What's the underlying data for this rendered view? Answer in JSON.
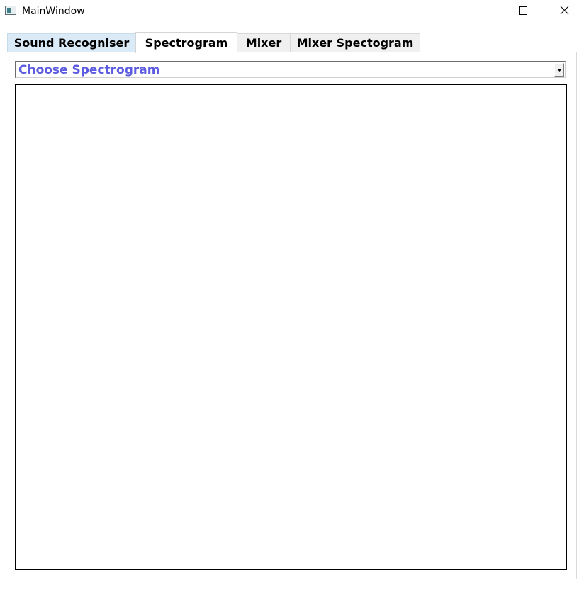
{
  "window": {
    "title": "MainWindow",
    "icon": "app-window-icon",
    "controls": [
      "minimize-icon",
      "maximize-icon",
      "close-icon"
    ]
  },
  "tabs": [
    {
      "label": "Sound Recogniser",
      "selected": false,
      "hovered": true
    },
    {
      "label": "Spectrogram",
      "selected": true
    },
    {
      "label": "Mixer",
      "selected": false
    },
    {
      "label": "Mixer Spectogram",
      "selected": false
    }
  ],
  "spectrogram_tab": {
    "combo": {
      "placeholder": "Choose Spectrogram",
      "text_color": "#5c5ce0",
      "arrow_icon": "dropdown-arrow-icon"
    }
  },
  "colors": {
    "hover_tab": "#daeaf7",
    "inactive_tab": "#f0f0f0",
    "panel_border": "#d9d9d9"
  }
}
